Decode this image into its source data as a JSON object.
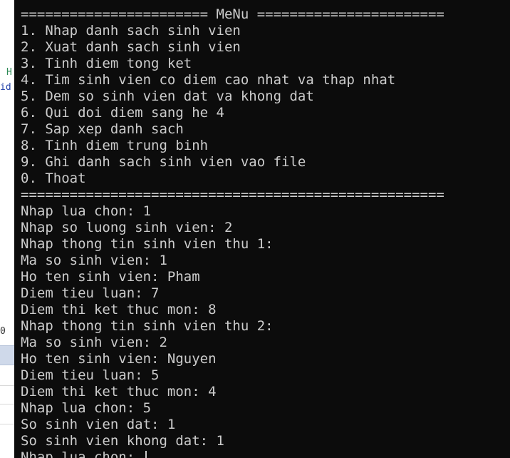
{
  "ide_background": {
    "fragments": [
      "H",
      "id",
      "0"
    ]
  },
  "console": {
    "menu_header": "======================= MeNu =======================",
    "menu_items": [
      "1. Nhap danh sach sinh vien",
      "2. Xuat danh sach sinh vien",
      "3. Tinh diem tong ket",
      "4. Tim sinh vien co diem cao nhat va thap nhat",
      "5. Dem so sinh vien dat va khong dat",
      "6. Qui doi diem sang he 4",
      "7. Sap xep danh sach",
      "8. Tinh diem trung binh",
      "9. Ghi danh sach sinh vien vao file",
      "0. Thoat"
    ],
    "menu_footer": "====================================================",
    "session_lines": [
      "Nhap lua chon: 1",
      "Nhap so luong sinh vien: 2",
      "Nhap thong tin sinh vien thu 1:",
      "Ma so sinh vien: 1",
      "Ho ten sinh vien: Pham",
      "Diem tieu luan: 7",
      "Diem thi ket thuc mon: 8",
      "Nhap thong tin sinh vien thu 2:",
      "Ma so sinh vien: 2",
      "Ho ten sinh vien: Nguyen",
      "Diem tieu luan: 5",
      "Diem thi ket thuc mon: 4",
      "Nhap lua chon: 5",
      "So sinh vien dat: 1",
      "So sinh vien khong dat: 1"
    ],
    "input_prompt": "Nhap lua chon: "
  },
  "colors": {
    "console_background": "#0c0c0c",
    "console_text": "#cccccc"
  }
}
